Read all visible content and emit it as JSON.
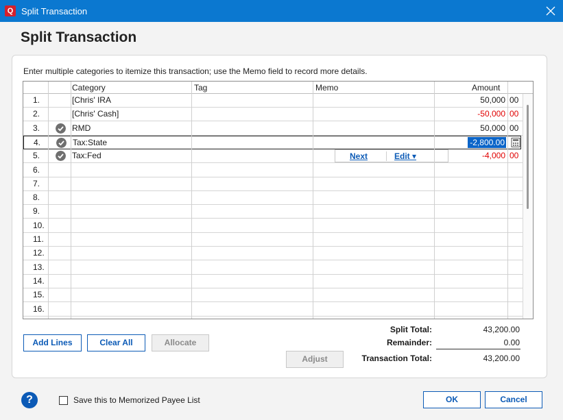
{
  "window": {
    "app_logo": "Q",
    "title": "Split Transaction",
    "close_icon": "close-icon"
  },
  "heading": "Split Transaction",
  "instructions": "Enter multiple categories to itemize this transaction; use the Memo field to record more details.",
  "columns": {
    "category": "Category",
    "tag": "Tag",
    "memo": "Memo",
    "amount": "Amount"
  },
  "rows": [
    {
      "num": "1.",
      "checked": false,
      "category": "[Chris' IRA",
      "amount": "50,000",
      "cents": "00",
      "negative": false
    },
    {
      "num": "2.",
      "checked": false,
      "category": "[Chris' Cash]",
      "amount": "-50,000",
      "cents": "00",
      "negative": true
    },
    {
      "num": "3.",
      "checked": true,
      "category": "RMD",
      "amount": "50,000",
      "cents": "00",
      "negative": false
    },
    {
      "num": "4.",
      "checked": true,
      "category": "Tax:State",
      "amount": "-2,800.00",
      "cents": "",
      "negative": true,
      "editing": true
    },
    {
      "num": "5.",
      "checked": true,
      "category": "Tax:Fed",
      "amount": "-4,000",
      "cents": "00",
      "negative": true
    },
    {
      "num": "6.",
      "checked": false,
      "category": "",
      "amount": "",
      "cents": ""
    },
    {
      "num": "7.",
      "checked": false,
      "category": "",
      "amount": "",
      "cents": ""
    },
    {
      "num": "8.",
      "checked": false,
      "category": "",
      "amount": "",
      "cents": ""
    },
    {
      "num": "9.",
      "checked": false,
      "category": "",
      "amount": "",
      "cents": ""
    },
    {
      "num": "10.",
      "checked": false,
      "category": "",
      "amount": "",
      "cents": ""
    },
    {
      "num": "11.",
      "checked": false,
      "category": "",
      "amount": "",
      "cents": ""
    },
    {
      "num": "12.",
      "checked": false,
      "category": "",
      "amount": "",
      "cents": ""
    },
    {
      "num": "13.",
      "checked": false,
      "category": "",
      "amount": "",
      "cents": ""
    },
    {
      "num": "14.",
      "checked": false,
      "category": "",
      "amount": "",
      "cents": ""
    },
    {
      "num": "15.",
      "checked": false,
      "category": "",
      "amount": "",
      "cents": ""
    },
    {
      "num": "16.",
      "checked": false,
      "category": "",
      "amount": "",
      "cents": ""
    }
  ],
  "row_actions": {
    "next_label": "Next",
    "edit_label": "Edit ▾"
  },
  "buttons": {
    "add_lines": "Add Lines",
    "clear_all": "Clear All",
    "allocate": "Allocate",
    "adjust": "Adjust",
    "ok": "OK",
    "cancel": "Cancel"
  },
  "totals": {
    "split_total_label": "Split Total:",
    "split_total_value": "43,200.00",
    "remainder_label": "Remainder:",
    "remainder_value": "0.00",
    "transaction_total_label": "Transaction Total:",
    "transaction_total_value": "43,200.00"
  },
  "footer": {
    "help_icon": "?",
    "memorize_label": "Save this to Memorized Payee List",
    "memorize_checked": false
  },
  "colors": {
    "titlebar": "#0b78d0",
    "link": "#0b5ab6",
    "negative": "#e00000",
    "selection": "#0a64c8"
  }
}
